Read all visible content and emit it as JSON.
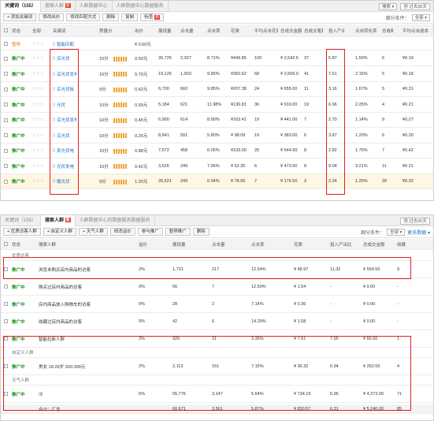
{
  "p1": {
    "tabs": [
      "关键词（155）",
      "搜索人群",
      "人群数据中心",
      "人群数据中心数据服务"
    ],
    "new_badge": "新",
    "right_label": "搜索",
    "date_label": "过去30天",
    "toolbar": [
      "+ 添加关键词",
      "修改出价",
      "修改匹配方式",
      "删除",
      "复制",
      "标签"
    ],
    "filter_label": "细分条件：",
    "filter_value": "全部",
    "headers": [
      "状态",
      "全部",
      "关键词",
      "质量分",
      "出价",
      "展现量",
      "点击量",
      "点击率",
      "花费",
      "平均点击花费",
      "总成交金额",
      "总成交笔数",
      "投入产出比",
      "点击转化率",
      "总收藏数",
      "平均点击成本"
    ],
    "rows": [
      {
        "status": "暂停",
        "kw": "智能匹配",
        "qs": "",
        "bid": "¥ 0.60元",
        "imp": "",
        "clk": "",
        "ctr": "",
        "cost": "",
        "cpc": "",
        "amt": "",
        "ord": "",
        "roi": "",
        "cvr": "",
        "fav": "",
        "acp": ""
      },
      {
        "status": "推广中",
        "kw": "买光伏",
        "qs": "10分",
        "bid": "0.50元",
        "imp": "26,725",
        "clk": "2,327",
        "ctr": "8.71%",
        "cost": "¥449.85",
        "cpc": "100",
        "amt": "¥ 2,642.5",
        "ord": "37",
        "roi": "5.87",
        "cvr": "1.59%",
        "fav": "6",
        "acp": "¥0.19"
      },
      {
        "status": "推广中",
        "kw": "买光伏发电",
        "qs": "10分",
        "bid": "0.70元",
        "imp": "19,126",
        "clk": "1,903",
        "ctr": "9.95%",
        "cost": "¥350.62",
        "cpc": "68",
        "amt": "¥ 2,669.0",
        "ord": "41",
        "roi": "7.61",
        "cvr": "2.15%",
        "fav": "5",
        "acp": "¥0.18"
      },
      {
        "status": "推广中",
        "kw": "买光伏板",
        "qs": "9分",
        "bid": "0.62元",
        "imp": "6,700",
        "clk": "660",
        "ctr": "9.85%",
        "cost": "¥207.38",
        "cpc": "24",
        "amt": "¥ 655.00",
        "ord": "11",
        "roi": "3.16",
        "cvr": "1.67%",
        "fav": "5",
        "acp": "¥0.31"
      },
      {
        "status": "推广中",
        "kw": "光伏",
        "qs": "10分",
        "bid": "0.59元",
        "imp": "5,184",
        "clk": "621",
        "ctr": "11.98%",
        "cost": "¥130.81",
        "cpc": "36",
        "amt": "¥ 910.00",
        "ord": "19",
        "roi": "6.96",
        "cvr": "2.25%",
        "fav": "4",
        "acp": "¥0.21"
      },
      {
        "status": "推广中",
        "kw": "买光伏发电",
        "qs": "10分",
        "bid": "0.45元",
        "imp": "6,900",
        "clk": "614",
        "ctr": "8.90%",
        "cost": "¥163.41",
        "cpc": "19",
        "amt": "¥ 441.00",
        "ord": "7",
        "roi": "2.70",
        "cvr": "1.14%",
        "fav": "9",
        "acp": "¥0.27"
      },
      {
        "status": "推广中",
        "kw": "买光伏",
        "qs": "10分",
        "bid": "0.26元",
        "imp": "8,641",
        "clk": "501",
        "ctr": "5.80%",
        "cost": "¥ 98.09",
        "cpc": "19",
        "amt": "¥ 383.00",
        "ord": "6",
        "roi": "3.87",
        "cvr": "1.20%",
        "fav": "6",
        "acp": "¥0.20"
      },
      {
        "status": "推广中",
        "kw": "卖光伏电",
        "qs": "10分",
        "bid": "0.88元",
        "imp": "7,572",
        "clk": "458",
        "ctr": "6.05%",
        "cost": "¥193.00",
        "cpc": "25",
        "amt": "¥ 544.50",
        "ord": "8",
        "roi": "2.82",
        "cvr": "1.75%",
        "fav": "7",
        "acp": "¥0.42"
      },
      {
        "status": "推广中",
        "kw": "光伏发电",
        "qs": "10分",
        "bid": "0.42元",
        "imp": "3,526",
        "clk": "249",
        "ctr": "7.06%",
        "cost": "¥ 52.35",
        "cpc": "6",
        "amt": "¥ 473.50",
        "ord": "8",
        "roi": "9.04",
        "cvr": "3.21%",
        "fav": "11",
        "acp": "¥0.21"
      },
      {
        "status": "推广中",
        "kw": "载光伏",
        "qs": "9分",
        "bid": "1.20元",
        "imp": "26,521",
        "clk": "249",
        "ctr": "0.94%",
        "cost": "¥ 78.65",
        "cpc": "7",
        "amt": "¥ 176.50",
        "ord": "3",
        "roi": "2.24",
        "cvr": "1.20%",
        "fav": "39",
        "acp": "¥0.32"
      }
    ]
  },
  "p2": {
    "tabs": [
      "关键词（155）",
      "搜索人群",
      "人群数据中心的数据服务数据服务"
    ],
    "new_badge": "新",
    "date_label": "过去30天",
    "toolbar": [
      "+ 优质访客人群",
      "+ 自定义人群",
      "+ 天气人群",
      "修改溢价",
      "参与推广",
      "暂停推广",
      "删除"
    ],
    "filter_label": "细分条件：",
    "filter_value": "全部",
    "more_data": "更多数据",
    "headers": [
      "状态",
      "搜索人群",
      "溢价",
      "展现量",
      "点击量",
      "点击率",
      "花费",
      "投入产出比",
      "总成交金额",
      "收藏"
    ],
    "rows": [
      {
        "type": "section",
        "name": "优质访客"
      },
      {
        "type": "data",
        "status": "推广中",
        "name": "浏览未购买店内商品的访客",
        "prem": "2%",
        "imp": "1,731",
        "clk": "217",
        "ctr": "12.54%",
        "cost": "¥ 48.97",
        "roi": "11.32",
        "amt": "¥ 554.50",
        "fav": "9"
      },
      {
        "type": "data",
        "status": "推广中",
        "name": "购买过店内商品的访客",
        "prem": "0%",
        "imp": "56",
        "clk": "7",
        "ctr": "12.50%",
        "cost": "¥ 1.54",
        "roi": "-",
        "amt": "¥ 0.00",
        "fav": "-"
      },
      {
        "type": "data",
        "status": "推广中",
        "name": "店内商品放入购物车的访客",
        "prem": "0%",
        "imp": "28",
        "clk": "2",
        "ctr": "7.14%",
        "cost": "¥ 0.36",
        "roi": "-",
        "amt": "¥ 0.00",
        "fav": "-"
      },
      {
        "type": "data",
        "status": "推广中",
        "name": "收藏过店内商品的访客",
        "prem": "0%",
        "imp": "42",
        "clk": "6",
        "ctr": "14.29%",
        "cost": "¥ 1.58",
        "roi": "-",
        "amt": "¥ 0.00",
        "fav": "-"
      },
      {
        "type": "data",
        "status": "推广中",
        "name": "智能拉新人群",
        "prem": "2%",
        "imp": "925",
        "clk": "31",
        "ctr": "3.35%",
        "cost": "¥ 7.61",
        "roi": "7.95",
        "amt": "¥ 60.50",
        "fav": "1"
      },
      {
        "type": "section",
        "name": "自定义人群"
      },
      {
        "type": "data",
        "status": "推广中",
        "name": "男女 18-29岁 300-399元",
        "prem": "2%",
        "imp": "2,113",
        "clk": "151",
        "ctr": "7.15%",
        "cost": "¥ 36.32",
        "roi": "6.94",
        "amt": "¥ 252.00",
        "fav": "4"
      },
      {
        "type": "section",
        "name": "天气人群"
      },
      {
        "type": "data",
        "status": "推广中",
        "name": "冷",
        "prem": "5%",
        "imp": "55,776",
        "clk": "3,147",
        "ctr": "5.64%",
        "cost": "¥ 734.19",
        "roi": "5.96",
        "amt": "¥ 4,373.00",
        "fav": "71"
      }
    ],
    "footer": {
      "label": "合计：汇总",
      "imp": "60,671",
      "clk": "3,561",
      "ctr": "5.87%",
      "cost": "¥ 830.57",
      "roi": "6.31",
      "amt": "¥ 5,240.00",
      "fav": "85"
    }
  }
}
